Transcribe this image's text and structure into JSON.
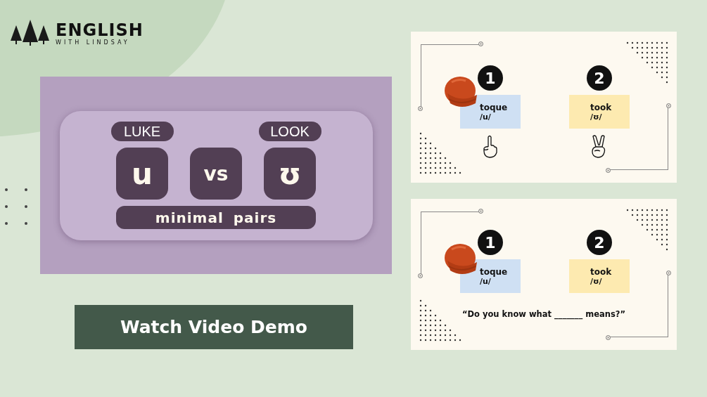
{
  "logo": {
    "title": "ENGLISH",
    "subtitle": "WITH LINDSAY"
  },
  "thumbnail": {
    "pairs": [
      {
        "word": "LUKE",
        "symbol": "u"
      },
      {
        "word": "LOOK",
        "symbol": "ʊ"
      }
    ],
    "vs": "vs",
    "caption": "minimal pairs"
  },
  "button": {
    "label": "Watch Video Demo"
  },
  "slides": [
    {
      "words": [
        {
          "number": "1",
          "word": "toque",
          "ipa": "/u/",
          "color": "#cfe0f3",
          "kind": "one"
        },
        {
          "number": "2",
          "word": "took",
          "ipa": "/ʊ/",
          "color": "#fdeab0",
          "kind": "two"
        }
      ]
    },
    {
      "words": [
        {
          "number": "1",
          "word": "toque",
          "ipa": "/u/",
          "color": "#cfe0f3"
        },
        {
          "number": "2",
          "word": "took",
          "ipa": "/ʊ/",
          "color": "#fdeab0"
        }
      ],
      "question": "“Do you know what _______ means?”"
    }
  ]
}
